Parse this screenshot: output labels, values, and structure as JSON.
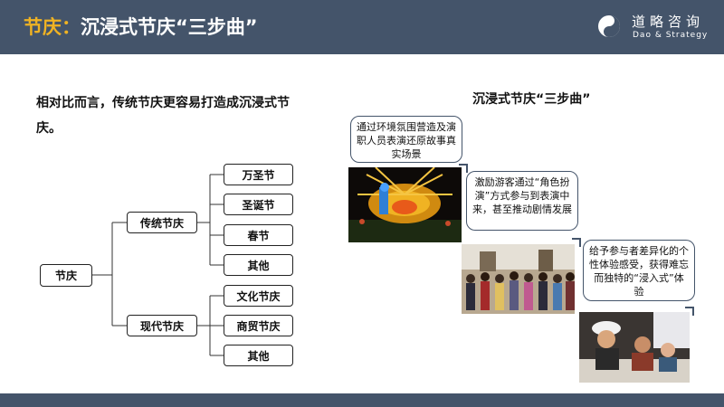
{
  "header": {
    "title_accent": "节庆：",
    "title_main": "沉浸式节庆“三步曲”",
    "logo_cn": "道略咨询",
    "logo_en": "Dao & Strategy"
  },
  "intro": "相对比而言，传统节庆更容易打造成沉浸式节庆。",
  "tree": {
    "root": "节庆",
    "traditional": {
      "label": "传统节庆",
      "children": [
        "万圣节",
        "圣诞节",
        "春节",
        "其他"
      ]
    },
    "modern": {
      "label": "现代节庆",
      "children": [
        "文化节庆",
        "商贸节庆",
        "其他"
      ]
    }
  },
  "steps": {
    "title": "沉浸式节庆“三步曲”",
    "step1": "通过环境氛围营造及演职人员表演还原故事真实场景",
    "step2": "激励游客通过“角色扮演”方式参与到表演中来，甚至推动剧情发展",
    "step3": "给予参与者差异化的个性体验感受，获得难忘而独特的“浸入式”体验"
  },
  "colors": {
    "header_bg": "#44546a",
    "accent": "#f0b323"
  }
}
